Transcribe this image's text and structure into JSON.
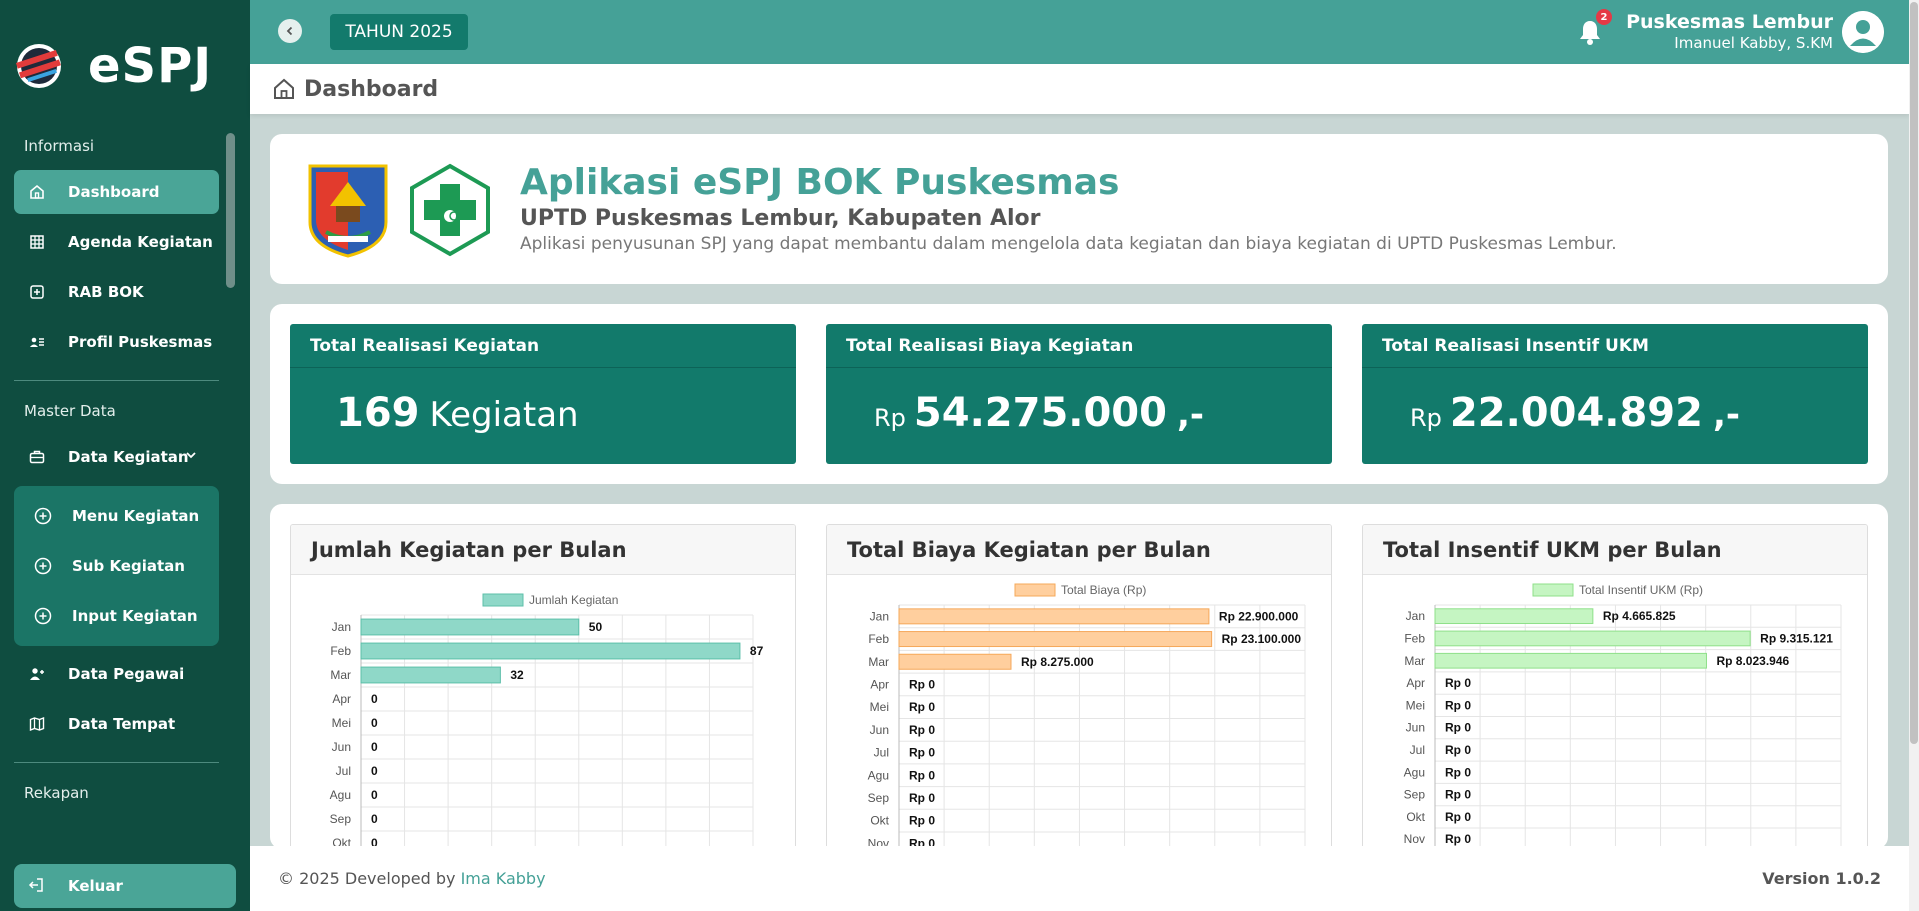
{
  "app": {
    "name": "eSPJ"
  },
  "sidebar": {
    "sections": {
      "info": "Informasi",
      "master": "Master Data",
      "rekapan": "Rekapan"
    },
    "items": [
      {
        "label": "Dashboard",
        "icon": "home-icon"
      },
      {
        "label": "Agenda Kegiatan",
        "icon": "grid-icon"
      },
      {
        "label": "RAB BOK",
        "icon": "plus-square-icon"
      },
      {
        "label": "Profil Puskesmas",
        "icon": "id-card-icon"
      },
      {
        "label": "Data Kegiatan",
        "icon": "briefcase-icon"
      },
      {
        "label": "Data Pegawai",
        "icon": "user-plus-icon"
      },
      {
        "label": "Data Tempat",
        "icon": "map-icon"
      }
    ],
    "sub_items": [
      {
        "label": "Menu Kegiatan",
        "icon": "plus-circle-icon"
      },
      {
        "label": "Sub Kegiatan",
        "icon": "plus-circle-icon"
      },
      {
        "label": "Input Kegiatan",
        "icon": "plus-circle-icon"
      }
    ],
    "logout": "Keluar"
  },
  "topbar": {
    "year": "TAHUN 2025",
    "notif_count": "2",
    "org": "Puskesmas Lembur",
    "user": "Imanuel Kabby, S.KM"
  },
  "page": {
    "title": "Dashboard"
  },
  "hero": {
    "title": "Aplikasi eSPJ BOK Puskesmas",
    "subtitle": "UPTD Puskesmas Lembur, Kabupaten Alor",
    "description": "Aplikasi penyusunan SPJ yang dapat membantu dalam mengelola data kegiatan dan biaya kegiatan di UPTD Puskesmas Lembur."
  },
  "stats": [
    {
      "title": "Total Realisasi Kegiatan",
      "value": "169",
      "unit": "Kegiatan"
    },
    {
      "title": "Total Realisasi Biaya Kegiatan",
      "prefix": "Rp",
      "value": "54.275.000",
      "suffix": ",-"
    },
    {
      "title": "Total Realisasi Insentif UKM",
      "prefix": "Rp",
      "value": "22.004.892",
      "suffix": ",-"
    }
  ],
  "colors": {
    "primary": "#45a197",
    "sidebar": "#0f4d40",
    "stat_bg": "#127a6b"
  },
  "chart_data": [
    {
      "type": "bar",
      "orientation": "horizontal",
      "title": "Jumlah Kegiatan per Bulan",
      "legend": "Jumlah Kegiatan",
      "color": "#8fd8c8",
      "border": "#5cbfa9",
      "categories": [
        "Jan",
        "Feb",
        "Mar",
        "Apr",
        "Mei",
        "Jun",
        "Jul",
        "Agu",
        "Sep",
        "Okt"
      ],
      "values": [
        50,
        87,
        32,
        0,
        0,
        0,
        0,
        0,
        0,
        0
      ],
      "labels": [
        "50",
        "87",
        "32",
        "0",
        "0",
        "0",
        "0",
        "0",
        "0",
        "0"
      ],
      "xlim": [
        0,
        90
      ]
    },
    {
      "type": "bar",
      "orientation": "horizontal",
      "title": "Total Biaya Kegiatan per Bulan",
      "legend": "Total Biaya (Rp)",
      "color": "#ffcf9e",
      "border": "#f5a85a",
      "categories": [
        "Jan",
        "Feb",
        "Mar",
        "Apr",
        "Mei",
        "Jun",
        "Jul",
        "Agu",
        "Sep",
        "Okt",
        "Nov"
      ],
      "values": [
        22900000,
        23100000,
        8275000,
        0,
        0,
        0,
        0,
        0,
        0,
        0,
        0
      ],
      "labels": [
        "Rp 22.900.000",
        "Rp 23.100.000",
        "Rp 8.275.000",
        "Rp 0",
        "Rp 0",
        "Rp 0",
        "Rp 0",
        "Rp 0",
        "Rp 0",
        "Rp 0",
        "Rp 0"
      ],
      "xlim": [
        0,
        30000000
      ]
    },
    {
      "type": "bar",
      "orientation": "horizontal",
      "title": "Total Insentif UKM per Bulan",
      "legend": "Total Insentif UKM (Rp)",
      "color": "#c5f5c2",
      "border": "#8fe08a",
      "categories": [
        "Jan",
        "Feb",
        "Mar",
        "Apr",
        "Mei",
        "Jun",
        "Jul",
        "Agu",
        "Sep",
        "Okt",
        "Nov"
      ],
      "values": [
        4665825,
        9315121,
        8023946,
        0,
        0,
        0,
        0,
        0,
        0,
        0,
        0
      ],
      "labels": [
        "Rp 4.665.825",
        "Rp 9.315.121",
        "Rp 8.023.946",
        "Rp 0",
        "Rp 0",
        "Rp 0",
        "Rp 0",
        "Rp 0",
        "Rp 0",
        "Rp 0",
        "Rp 0"
      ],
      "xlim": [
        0,
        12000000
      ]
    }
  ],
  "footer": {
    "copyright": "© 2025 Developed by",
    "author": "Ima Kabby",
    "version": "Version 1.0.2"
  }
}
